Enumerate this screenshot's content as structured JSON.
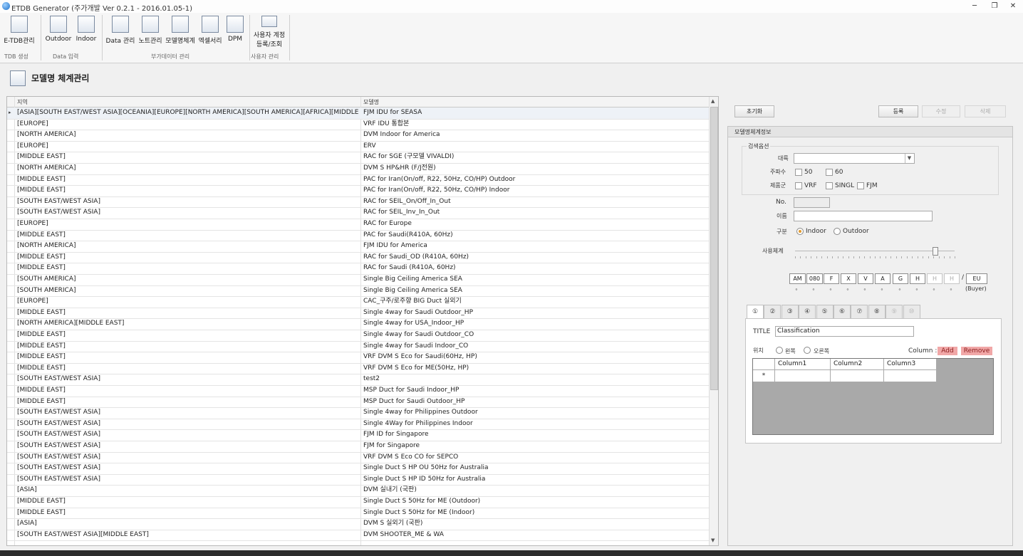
{
  "window": {
    "title": "ETDB Generator (주가개발 Ver 0.2.1 - 2016.01.05-1)"
  },
  "ribbon": {
    "buttons": [
      {
        "label": "E-TDB관리",
        "icon": "database-icon"
      },
      {
        "label": "Outdoor",
        "icon": "outdoor-unit-icon"
      },
      {
        "label": "Indoor",
        "icon": "indoor-unit-icon"
      },
      {
        "label": "Data 관리",
        "icon": "data-settings-icon"
      },
      {
        "label": "노트관리",
        "icon": "note-icon"
      },
      {
        "label": "모델명체계",
        "icon": "list-icon"
      },
      {
        "label": "엑셀서리",
        "icon": "accessory-icon"
      },
      {
        "label": "DPM",
        "icon": "dpm-icon"
      },
      {
        "label": "사용자 계정",
        "label2": "등록/조회",
        "icon": "user-account-icon"
      }
    ],
    "groups": [
      "TDB 생성",
      "Data 입력",
      "부가데이터 관리",
      "사용자 관리"
    ]
  },
  "page": {
    "title": "모델명 체계관리",
    "icon": "list-icon"
  },
  "grid": {
    "columns": [
      "지역",
      "모델명"
    ],
    "rows": [
      [
        "[ASIA][SOUTH EAST/WEST ASIA][OCEANIA][EUROPE][NORTH AMERICA][SOUTH AMERICA][AFRICA][MIDDLE EA...",
        "FJM IDU for SEASA"
      ],
      [
        "[EUROPE]",
        "VRF IDU 통합본"
      ],
      [
        "[NORTH AMERICA]",
        "DVM Indoor for America"
      ],
      [
        "[EUROPE]",
        "ERV"
      ],
      [
        "[MIDDLE EAST]",
        "RAC for SGE (구모델 VIVALDI)"
      ],
      [
        "[NORTH AMERICA]",
        "DVM S HP&HR (F/J전원)"
      ],
      [
        "[MIDDLE EAST]",
        "PAC for Iran(On/off, R22, 50Hz, CO/HP) Outdoor"
      ],
      [
        "[MIDDLE EAST]",
        "PAC for Iran(On/off, R22, 50Hz, CO/HP) Indoor"
      ],
      [
        "[SOUTH EAST/WEST ASIA]",
        "RAC for SEIL_On/Off_In_Out"
      ],
      [
        "[SOUTH EAST/WEST ASIA]",
        "RAC for SEIL_Inv_In_Out"
      ],
      [
        "[EUROPE]",
        "RAC for Europe"
      ],
      [
        "[MIDDLE EAST]",
        "PAC for Saudi(R410A, 60Hz)"
      ],
      [
        "[NORTH AMERICA]",
        "FJM IDU for America"
      ],
      [
        "[MIDDLE EAST]",
        "RAC for Saudi_OD (R410A, 60Hz)"
      ],
      [
        "[MIDDLE EAST]",
        "RAC for Saudi (R410A, 60Hz)"
      ],
      [
        "[SOUTH AMERICA]",
        "Single Big Ceiling America SEA"
      ],
      [
        "[SOUTH AMERICA]",
        "Single Big Ceiling America SEA"
      ],
      [
        "[EUROPE]",
        "CAC_구주/로주향 BIG Duct 실외기"
      ],
      [
        "[MIDDLE EAST]",
        "Single 4way for Saudi Outdoor_HP"
      ],
      [
        "[NORTH AMERICA][MIDDLE EAST]",
        "Single 4way for USA_Indoor_HP"
      ],
      [
        "[MIDDLE EAST]",
        "Single 4way for Saudi Outdoor_CO"
      ],
      [
        "[MIDDLE EAST]",
        "Single 4way for Saudi Indoor_CO"
      ],
      [
        "[MIDDLE EAST]",
        "VRF DVM S Eco for Saudi(60Hz, HP)"
      ],
      [
        "[MIDDLE EAST]",
        "VRF DVM S Eco for ME(50Hz, HP)"
      ],
      [
        "[SOUTH EAST/WEST ASIA]",
        "test2"
      ],
      [
        "[MIDDLE EAST]",
        "MSP Duct for Saudi Indoor_HP"
      ],
      [
        "[MIDDLE EAST]",
        "MSP Duct for Saudi Outdoor_HP"
      ],
      [
        "[SOUTH EAST/WEST ASIA]",
        "Single 4way for Philippines Outdoor"
      ],
      [
        "[SOUTH EAST/WEST ASIA]",
        "Single 4Way for Philippines Indoor"
      ],
      [
        "[SOUTH EAST/WEST ASIA]",
        "FJM ID for Singapore"
      ],
      [
        "[SOUTH EAST/WEST ASIA]",
        "FJM for Singapore"
      ],
      [
        "[SOUTH EAST/WEST ASIA]",
        "VRF DVM S Eco CO for SEPCO"
      ],
      [
        "[SOUTH EAST/WEST ASIA]",
        "Single Duct S HP OU 50Hz for Australia"
      ],
      [
        "[SOUTH EAST/WEST ASIA]",
        "Single Duct S HP ID 50Hz for Australia"
      ],
      [
        "[ASIA]",
        "DVM 실내기 (국판)"
      ],
      [
        "[MIDDLE EAST]",
        "Single Duct S 50Hz for ME (Outdoor)"
      ],
      [
        "[MIDDLE EAST]",
        "Single Duct S 50Hz for ME (Indoor)"
      ],
      [
        "[ASIA]",
        "DVM S 실외기 (국판)"
      ],
      [
        "[SOUTH EAST/WEST ASIA][MIDDLE EAST]",
        "DVM SHOOTER_ME & WA"
      ]
    ]
  },
  "actions": {
    "reset": "초기화",
    "register": "등록",
    "edit": "수정",
    "delete": "삭제"
  },
  "detail": {
    "title": "모델명체계정보",
    "search_title": "검색옵션",
    "category_label": "대륙",
    "category_value": "",
    "freq_label": "주파수",
    "freq_opts": [
      "50",
      "60"
    ],
    "product_label": "제품군",
    "product_opts": [
      "VRF",
      "SINGL",
      "FJM"
    ],
    "no_label": "No.",
    "no_value": "",
    "name_label": "이름",
    "name_value": "",
    "type_label": "구분",
    "type_opts": [
      "Indoor",
      "Outdoor"
    ],
    "type_selected": "Indoor",
    "system_label": "사용체계",
    "slider_level": 0.88,
    "codes": [
      "AM",
      "080",
      "F",
      "X",
      "V",
      "A",
      "G",
      "H",
      "H",
      "H"
    ],
    "codes_disabled": [
      false,
      false,
      false,
      false,
      false,
      false,
      false,
      false,
      true,
      true
    ],
    "slash": "/",
    "suffix": "EU",
    "buyer": "(Buyer)",
    "tabs": [
      "①",
      "②",
      "③",
      "④",
      "⑤",
      "⑥",
      "⑦",
      "⑧",
      "⑨",
      "⑩"
    ],
    "active_tab": 0,
    "title_label": "TITLE",
    "title_value": "Classification",
    "position_label": "위치",
    "position_opts": [
      "왼쪽",
      "오른쪽"
    ],
    "column_label": "Column :",
    "add": "Add",
    "remove": "Remove",
    "columns": [
      "Column1",
      "Column2",
      "Column3"
    ],
    "new_row_marker": "*"
  }
}
